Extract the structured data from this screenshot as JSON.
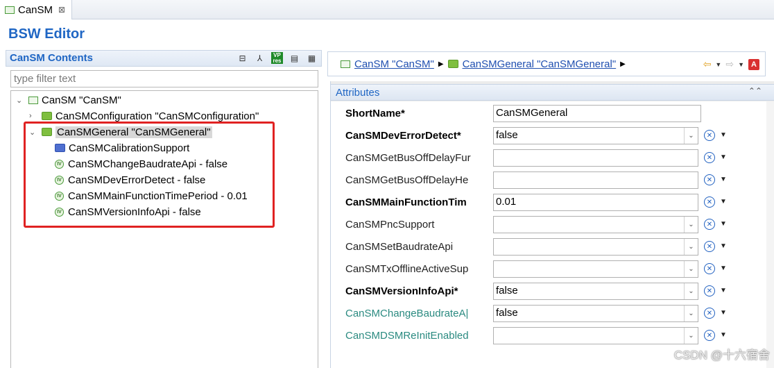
{
  "tab": {
    "label": "CanSM",
    "close": "⊠"
  },
  "editor": {
    "title": "BSW Editor"
  },
  "left": {
    "title": "CanSM Contents",
    "filter_placeholder": "type filter text",
    "toolbar_vp_label": "VP\nres"
  },
  "tree": [
    {
      "text": "CanSM \"CanSM\"",
      "twisty": "⌄",
      "icon": "module-icon"
    },
    {
      "text": "CanSMConfiguration \"CanSMConfiguration\"",
      "twisty": "›",
      "icon": "folder-icon"
    },
    {
      "text": "CanSMGeneral \"CanSMGeneral\"",
      "twisty": "⌄",
      "icon": "folder-icon",
      "selected": true
    },
    {
      "text": "CanSMCalibrationSupport",
      "icon": "container-icon"
    },
    {
      "text": "CanSMChangeBaudrateApi - false",
      "icon": "parameter-icon"
    },
    {
      "text": "CanSMDevErrorDetect - false",
      "icon": "parameter-icon"
    },
    {
      "text": "CanSMMainFunctionTimePeriod - 0.01",
      "icon": "parameter-icon"
    },
    {
      "text": "CanSMVersionInfoApi - false",
      "icon": "parameter-icon"
    }
  ],
  "breadcrumb": {
    "item1": "CanSM \"CanSM\"",
    "item2": "CanSMGeneral \"CanSMGeneral\""
  },
  "attributes": {
    "title": "Attributes",
    "rows": [
      {
        "label": "ShortName*",
        "value": "CanSMGeneral",
        "kind": "text-short"
      },
      {
        "label": "CanSMDevErrorDetect*",
        "value": "false",
        "kind": "select"
      },
      {
        "label": "CanSMGetBusOffDelayFur",
        "value": "",
        "kind": "text"
      },
      {
        "label": "CanSMGetBusOffDelayHe",
        "value": "",
        "kind": "text"
      },
      {
        "label": "CanSMMainFunctionTim",
        "value": "0.01",
        "kind": "text"
      },
      {
        "label": "CanSMPncSupport",
        "value": "",
        "kind": "select"
      },
      {
        "label": "CanSMSetBaudrateApi",
        "value": "",
        "kind": "select"
      },
      {
        "label": "CanSMTxOfflineActiveSup",
        "value": "",
        "kind": "select"
      },
      {
        "label": "CanSMVersionInfoApi*",
        "value": "false",
        "kind": "select"
      },
      {
        "label": "CanSMChangeBaudrateA|",
        "value": "false",
        "kind": "select"
      },
      {
        "label": "CanSMDSMReInitEnabled",
        "value": "",
        "kind": "select"
      }
    ]
  },
  "watermark": "CSDN @十六宿舍",
  "colors": {
    "accent": "#1f66c4",
    "highlight_box": "#e02222",
    "teal": "#2a8a80"
  }
}
